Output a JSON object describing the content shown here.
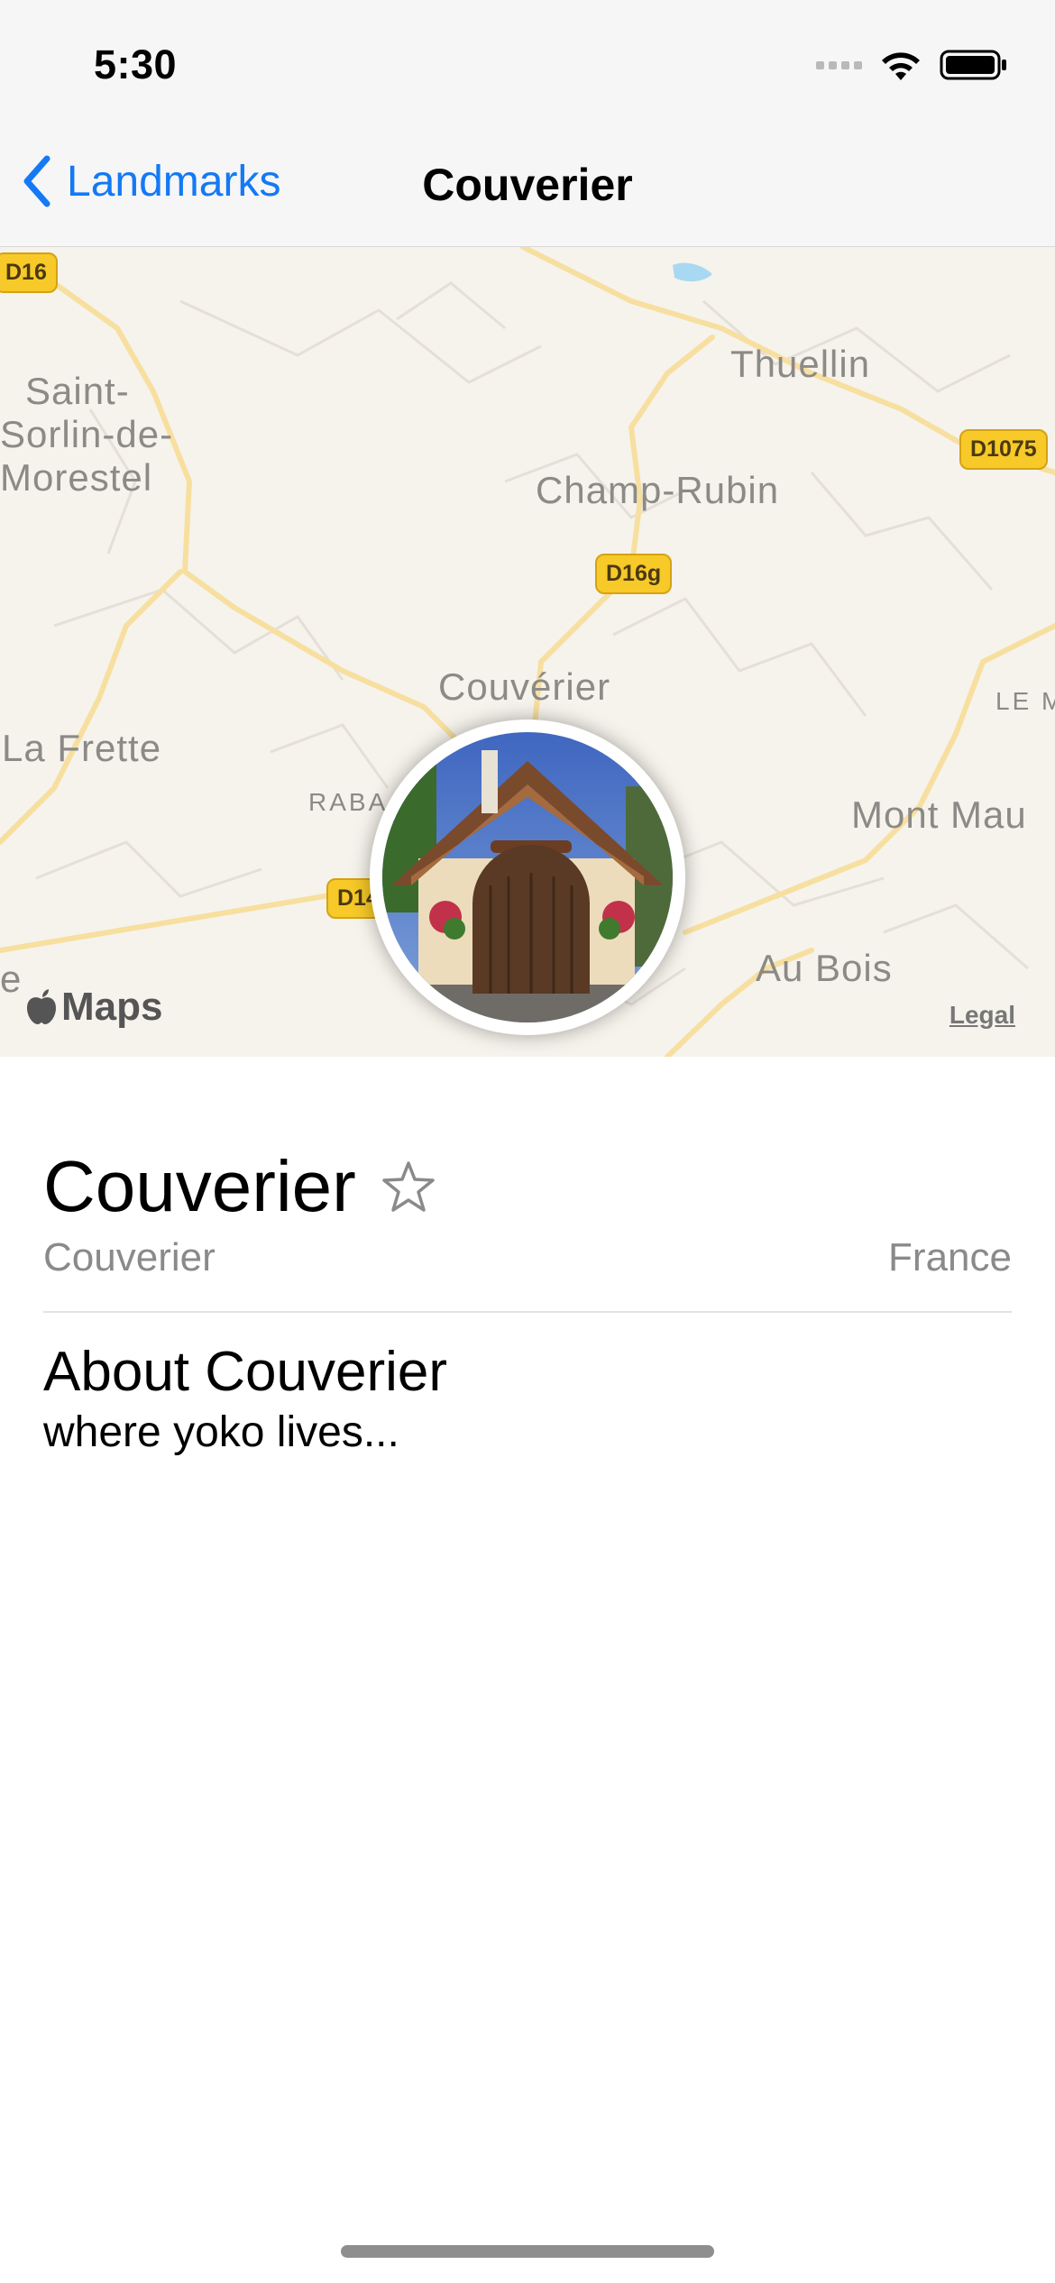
{
  "status_bar": {
    "time": "5:30"
  },
  "nav": {
    "back_label": "Landmarks",
    "title": "Couverier"
  },
  "map": {
    "places": {
      "saint_sorlin_1": "Saint-",
      "saint_sorlin_2": "Sorlin-de-",
      "saint_sorlin_3": "Morestel",
      "thuellin": "Thuellin",
      "champ_rubin": "Champ-Rubin",
      "couverier": "Couvérier",
      "la_frette": "La Frette",
      "raba": "RABA",
      "mont_mau": "Mont Mau",
      "le_m": "LE M",
      "au_bois": "Au Bois",
      "e": "e"
    },
    "routes": {
      "d16": "D16",
      "d1075": "D1075",
      "d16g": "D16g",
      "d14": "D14"
    },
    "maps_label": "Maps",
    "legal_label": "Legal"
  },
  "landmark": {
    "name": "Couverier",
    "park": "Couverier",
    "state": "France",
    "about_heading": "About Couverier",
    "description": "where yoko lives..."
  },
  "colors": {
    "accent": "#1479f5",
    "route_badge": "#f7c929",
    "map_bg": "#f6f3ec"
  }
}
